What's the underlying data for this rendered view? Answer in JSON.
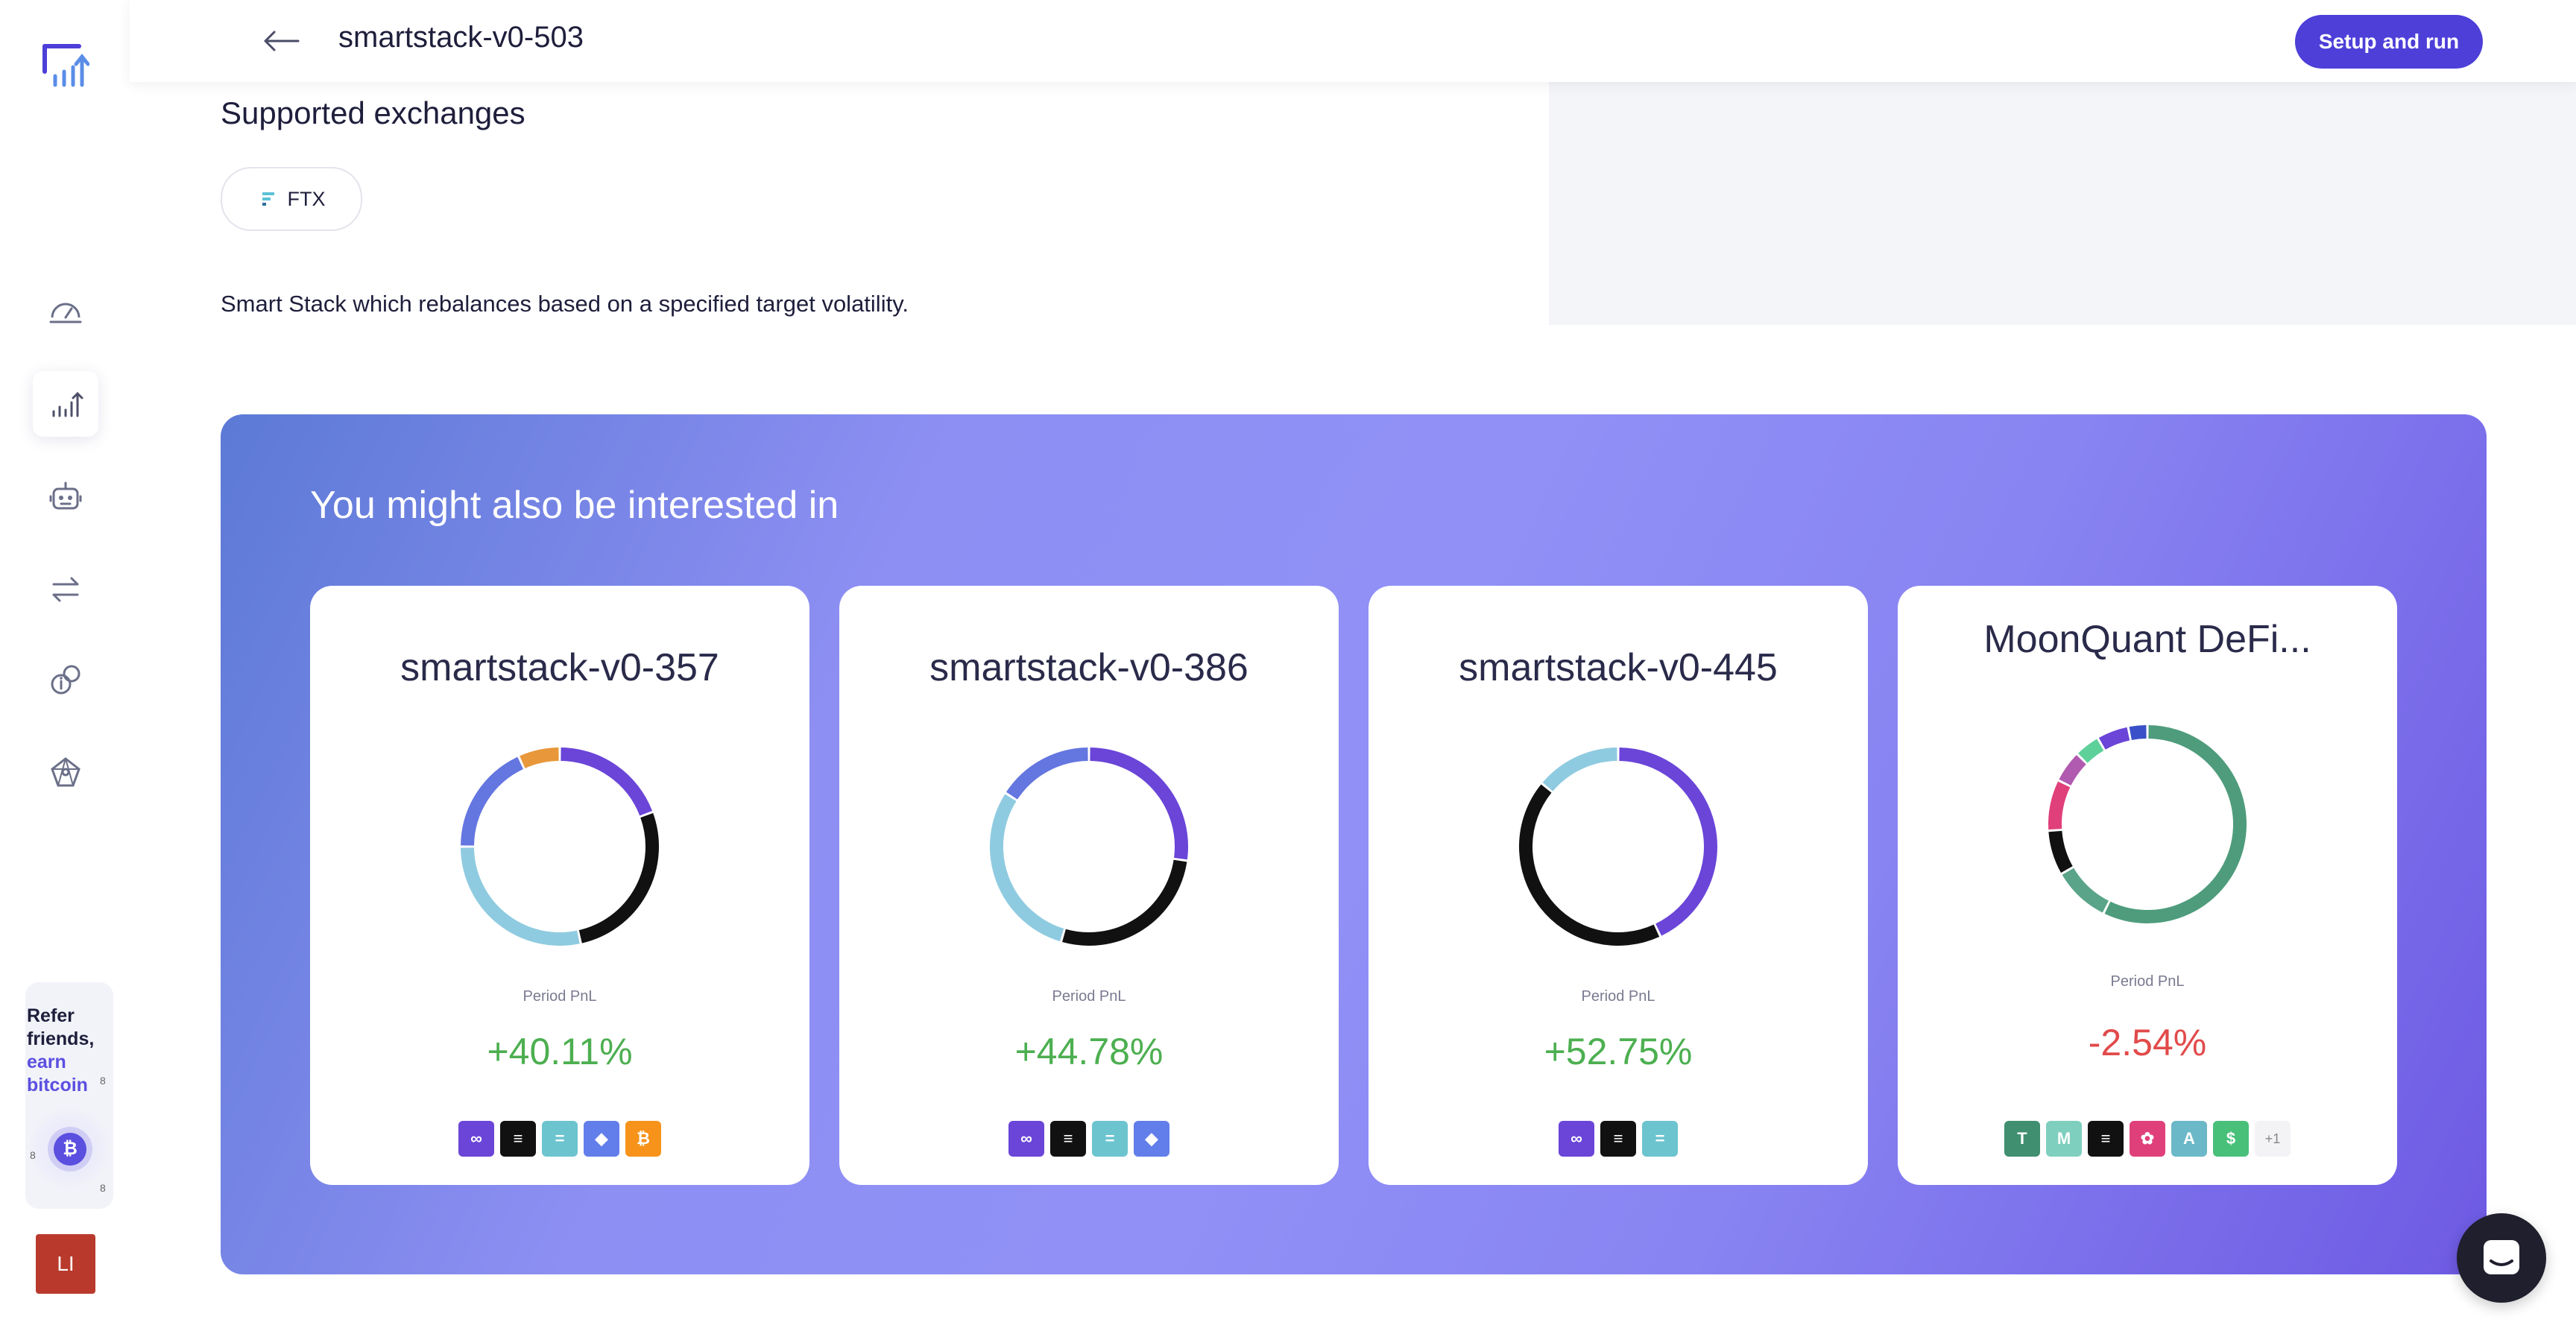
{
  "app": {
    "accent": "#4d3fd8"
  },
  "header": {
    "title": "smartstack-v0-503",
    "setup_button": "Setup and run",
    "back_icon": "arrow-left-icon"
  },
  "sidebar": {
    "logo": "chart-logo-icon",
    "items": [
      {
        "icon": "dashboard-gauge-icon",
        "active": false
      },
      {
        "icon": "strategies-chart-icon",
        "active": true
      },
      {
        "icon": "bot-icon",
        "active": false
      },
      {
        "icon": "swap-arrows-icon",
        "active": false
      },
      {
        "icon": "info-coin-icon",
        "active": false
      },
      {
        "icon": "network-star-icon",
        "active": false
      }
    ],
    "refer": {
      "line1": "Refer",
      "line2": "friends,",
      "line3": "earn",
      "line4": "bitcoin",
      "badge": "₿",
      "mini": "8"
    },
    "avatar": "LI"
  },
  "main": {
    "exchanges_title": "Supported exchanges",
    "exchange": "FTX",
    "description": "Smart Stack which rebalances based on a specified target volatility."
  },
  "promo": {
    "title": "You might also be interested in",
    "cards": [
      {
        "name": "smartstack-v0-357",
        "pnl_label": "Period PnL",
        "pnl": "+40.11%",
        "positive": true,
        "segments": [
          {
            "value": 17,
            "color": "#6a45d8"
          },
          {
            "value": 24,
            "color": "#111111"
          },
          {
            "value": 25,
            "color": "#8fcbe0"
          },
          {
            "value": 16,
            "color": "#6476e0"
          },
          {
            "value": 6,
            "color": "#e8973a"
          }
        ],
        "coins": [
          {
            "bg": "#6a45d8",
            "glyph": "∞"
          },
          {
            "bg": "#111111",
            "glyph": "≡"
          },
          {
            "bg": "#6cc4cf",
            "glyph": "="
          },
          {
            "bg": "#627eea",
            "glyph": "◆"
          },
          {
            "bg": "#f7931a",
            "glyph": "₿"
          }
        ]
      },
      {
        "name": "smartstack-v0-386",
        "pnl_label": "Period PnL",
        "pnl": "+44.78%",
        "positive": true,
        "segments": [
          {
            "value": 24,
            "color": "#6a45d8"
          },
          {
            "value": 24,
            "color": "#111111"
          },
          {
            "value": 26,
            "color": "#8fcbe0"
          },
          {
            "value": 14,
            "color": "#6476e0"
          }
        ],
        "coins": [
          {
            "bg": "#6a45d8",
            "glyph": "∞"
          },
          {
            "bg": "#111111",
            "glyph": "≡"
          },
          {
            "bg": "#6cc4cf",
            "glyph": "="
          },
          {
            "bg": "#627eea",
            "glyph": "◆"
          }
        ]
      },
      {
        "name": "smartstack-v0-445",
        "pnl_label": "Period PnL",
        "pnl": "+52.75%",
        "positive": true,
        "segments": [
          {
            "value": 43,
            "color": "#6a45d8"
          },
          {
            "value": 43,
            "color": "#111111"
          },
          {
            "value": 14,
            "color": "#8fcbe0"
          }
        ],
        "coins": [
          {
            "bg": "#6a45d8",
            "glyph": "∞"
          },
          {
            "bg": "#111111",
            "glyph": "≡"
          },
          {
            "bg": "#6cc4cf",
            "glyph": "="
          }
        ]
      },
      {
        "name": "MoonQuant DeFi...",
        "pnl_label": "Period PnL",
        "pnl": "-2.54%",
        "positive": false,
        "segments": [
          {
            "value": 55,
            "color": "#4e9c7c"
          },
          {
            "value": 9,
            "color": "#5aa48a"
          },
          {
            "value": 7,
            "color": "#111111"
          },
          {
            "value": 8,
            "color": "#e0407a"
          },
          {
            "value": 5,
            "color": "#b05ab0"
          },
          {
            "value": 4,
            "color": "#5ed09a"
          },
          {
            "value": 5,
            "color": "#6a45d8"
          },
          {
            "value": 3,
            "color": "#3a50c8"
          }
        ],
        "coins": [
          {
            "bg": "#3f8f70",
            "glyph": "T"
          },
          {
            "bg": "#7fcfbf",
            "glyph": "M"
          },
          {
            "bg": "#111111",
            "glyph": "≡"
          },
          {
            "bg": "#e0407a",
            "glyph": "✿"
          },
          {
            "bg": "#6bb8c8",
            "glyph": "A"
          },
          {
            "bg": "#48c07a",
            "glyph": "$"
          }
        ],
        "more": "+1"
      }
    ]
  },
  "chat_icon": "chat-bubble-icon"
}
